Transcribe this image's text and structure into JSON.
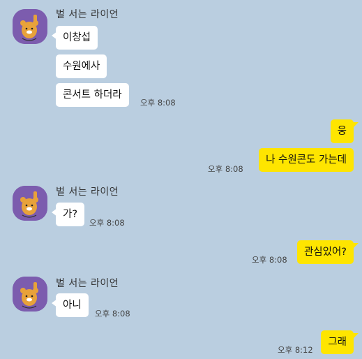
{
  "conversation": {
    "sender_name": "벌 서는 라이언",
    "group1": {
      "messages": [
        "이창섭",
        "수원에사",
        "콘서트 하더라"
      ],
      "time": "오후 8:08"
    },
    "out1": {
      "messages": [
        "웅",
        "나 수원콘도 가는데"
      ],
      "time": "오후 8:08"
    },
    "group2": {
      "messages": [
        "가?"
      ],
      "time": "오후 8:08"
    },
    "out2": {
      "messages": [
        "관심있어?"
      ],
      "time": "오후 8:08"
    },
    "group3": {
      "messages": [
        "아니"
      ],
      "time": "오후 8:08"
    },
    "out3": {
      "messages": [
        "그래"
      ],
      "time": "오후 8:12"
    }
  },
  "colors": {
    "background": "#bacee0",
    "incoming_bubble": "#ffffff",
    "outgoing_bubble": "#fee500",
    "avatar_bg": "#7c5cae"
  },
  "icons": {
    "avatar": "ryan-character-icon"
  }
}
